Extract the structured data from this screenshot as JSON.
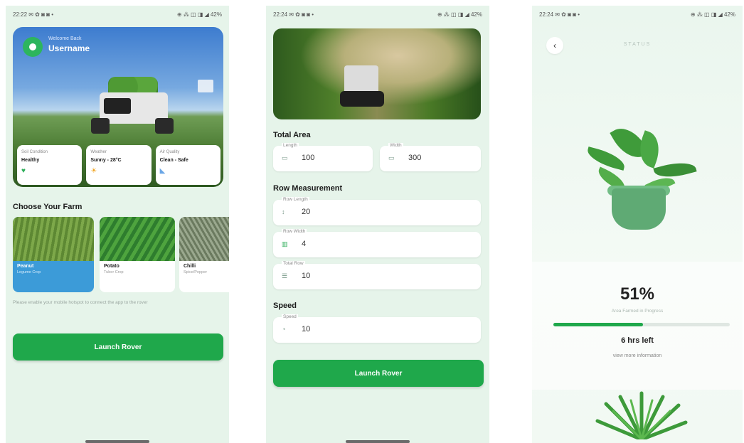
{
  "screen1": {
    "status_time": "22:22 ✉ ✿ ◙ ◙ •",
    "status_right": "⊕ ⁂ ◫ ◨ ◢ 42%",
    "welcome": "Welcome Back",
    "username": "Username",
    "stats": [
      {
        "label": "Soil Condition",
        "value": "Healthy",
        "icon": "♥",
        "color": "#2fae5a"
      },
      {
        "label": "Weather",
        "value": "Sunny - 28°C",
        "icon": "☀",
        "color": "#f0a21b"
      },
      {
        "label": "Air Quality",
        "value": "Clean - Safe",
        "icon": "◣",
        "color": "#6aa6e6"
      }
    ],
    "choose_title": "Choose Your Farm",
    "farms": [
      {
        "name": "Peanut",
        "sub": "Legume Crop"
      },
      {
        "name": "Potato",
        "sub": "Tuber Crop"
      },
      {
        "name": "Chilli",
        "sub": "Spice/Pepper"
      }
    ],
    "notice": "Please enable your mobile hotspot to connect the app to the rover",
    "launch_label": "Launch Rover"
  },
  "screen2": {
    "status_time": "22:24 ✉ ✿ ◙ ◙ •",
    "status_right": "⊕ ⁂ ◫ ◨ ◢ 42%",
    "total_area_title": "Total Area",
    "length_label": "Length",
    "length_value": "100",
    "width_label": "Width",
    "width_value": "300",
    "row_title": "Row Measurement",
    "row_length_label": "Row Length",
    "row_length_value": "20",
    "row_width_label": "Row Width",
    "row_width_value": "4",
    "total_row_label": "Total Row",
    "total_row_value": "10",
    "speed_title": "Speed",
    "speed_label": "Speed",
    "speed_value": "10",
    "launch_label": "Launch Rover"
  },
  "screen3": {
    "status_time": "22:24 ✉ ✿ ◙ ◙ •",
    "status_right": "⊕ ⁂ ◫ ◨ ◢ 42%",
    "title": "STATUS",
    "percent": "51%",
    "progress_fraction": 0.51,
    "progress_sub": "Area Farmed in Progress",
    "time_left": "6 hrs left",
    "more_info": "view more information"
  }
}
